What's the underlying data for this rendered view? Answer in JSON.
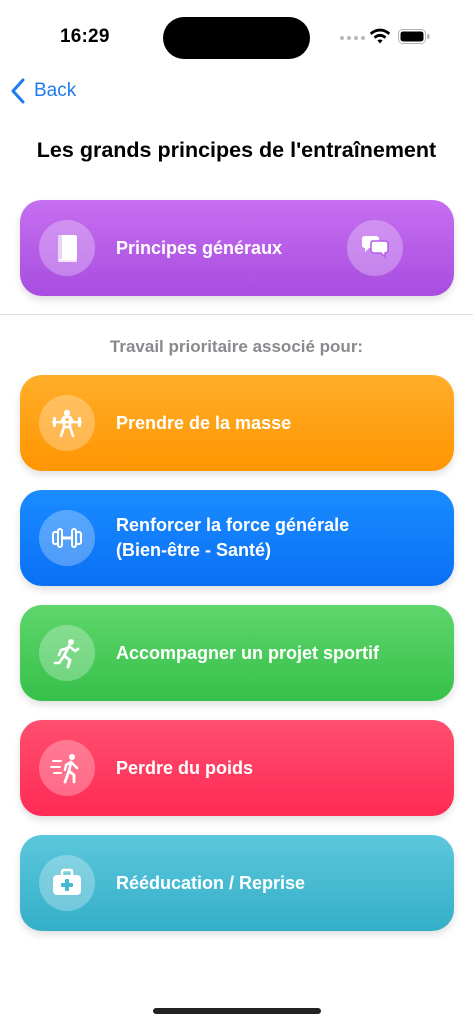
{
  "status_bar": {
    "time": "16:29"
  },
  "nav": {
    "back_label": "Back"
  },
  "page_title": "Les grands principes de l'entraînement",
  "general_card": {
    "label": "Principes généraux",
    "icon": "book-icon",
    "action_icon": "chat-bubbles-icon",
    "color": "#b85ee8"
  },
  "section_label": "Travail prioritaire associé pour:",
  "cards": [
    {
      "label": "Prendre de la masse",
      "icon": "weightlifter-icon",
      "color": "#ff9f1a"
    },
    {
      "label": "Renforcer la force générale\n(Bien-être - Santé)",
      "icon": "dumbbell-icon",
      "color": "#0f7df8"
    },
    {
      "label": "Accompagner un projet sportif",
      "icon": "runner-icon",
      "color": "#44c957"
    },
    {
      "label": "Perdre du poids",
      "icon": "fast-walker-icon",
      "color": "#ff3a5f"
    },
    {
      "label": "Rééducation / Reprise",
      "icon": "medical-kit-icon",
      "color": "#45bbd2"
    }
  ]
}
